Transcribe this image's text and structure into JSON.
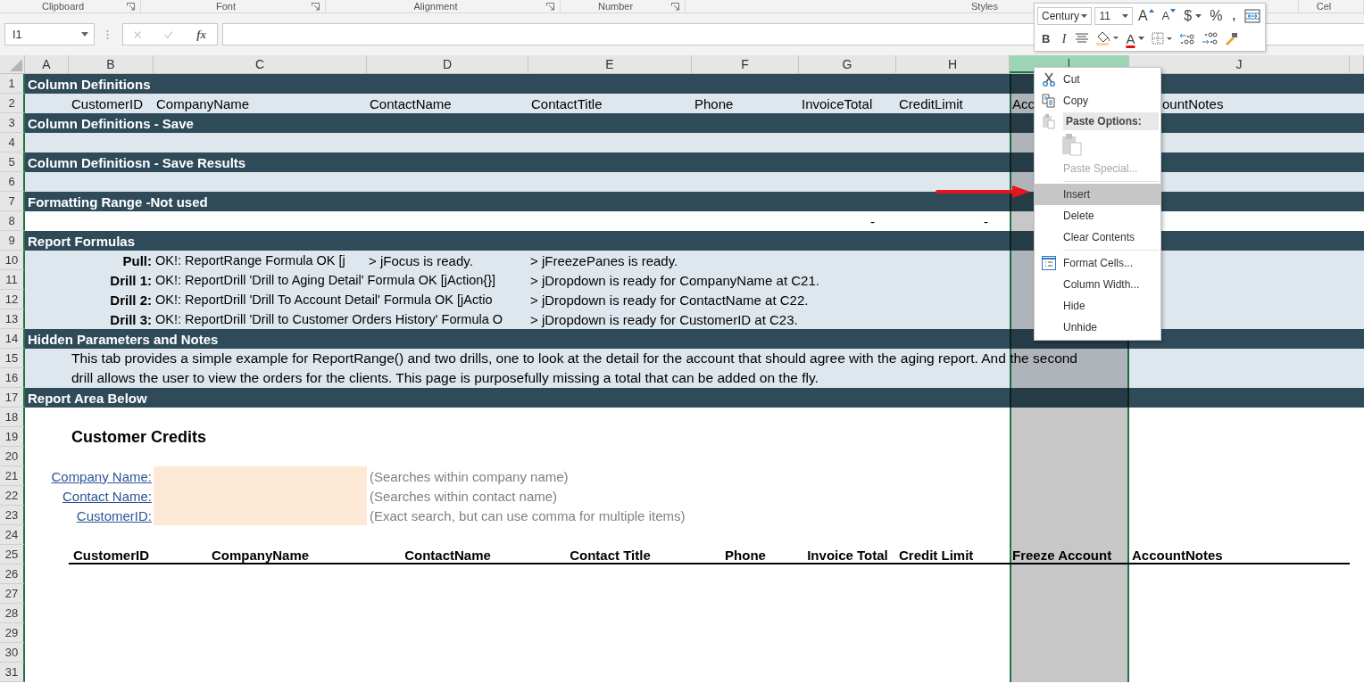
{
  "ribbon_groups": [
    {
      "label": "Clipboard",
      "launcher": true
    },
    {
      "label": "Font",
      "launcher": true
    },
    {
      "label": "Alignment",
      "launcher": true
    },
    {
      "label": "Number",
      "launcher": true
    },
    {
      "label": "Styles",
      "launcher": false
    },
    {
      "label": "Cel",
      "launcher": false
    }
  ],
  "formula_bar": {
    "name_box": "I1",
    "function_label": "fx"
  },
  "columns": [
    {
      "label": "A",
      "selected": false
    },
    {
      "label": "B",
      "selected": false
    },
    {
      "label": "C",
      "selected": false
    },
    {
      "label": "D",
      "selected": false
    },
    {
      "label": "E",
      "selected": false
    },
    {
      "label": "F",
      "selected": false
    },
    {
      "label": "G",
      "selected": false
    },
    {
      "label": "H",
      "selected": false
    },
    {
      "label": "I",
      "selected": true
    },
    {
      "label": "J",
      "selected": false
    }
  ],
  "rows": [
    {
      "n": "1",
      "kind": "section",
      "text": "Column Definitions"
    },
    {
      "n": "2",
      "kind": "fields",
      "cells": [
        "CustomerID",
        "CompanyName",
        "ContactName",
        "ContactTitle",
        "Phone",
        "InvoiceTotal",
        "CreditLimit",
        "Acc",
        "ountNotes"
      ]
    },
    {
      "n": "3",
      "kind": "section",
      "text": "Column Definitions - Save"
    },
    {
      "n": "4",
      "kind": "band"
    },
    {
      "n": "5",
      "kind": "section",
      "text": "Column Definitiosn - Save Results"
    },
    {
      "n": "6",
      "kind": "band"
    },
    {
      "n": "7",
      "kind": "section",
      "text": "Formatting Range -Not used"
    },
    {
      "n": "8",
      "kind": "dashes",
      "values": [
        "-",
        "-"
      ]
    },
    {
      "n": "9",
      "kind": "section",
      "text": "Report Formulas"
    },
    {
      "n": "10",
      "kind": "formula",
      "label": "Pull:",
      "status": "OK!: ReportRange Formula OK [j",
      "column_d": "> jFocus is ready.",
      "column_e": "> jFreezePanes is ready."
    },
    {
      "n": "11",
      "kind": "formula",
      "label": "Drill 1:",
      "status": "OK!: ReportDrill 'Drill to Aging Detail' Formula OK [jAction{}]",
      "column_e": "> jDropdown is ready for CompanyName at C21."
    },
    {
      "n": "12",
      "kind": "formula",
      "label": "Drill 2:",
      "status": "OK!: ReportDrill 'Drill To Account Detail' Formula OK [jActio",
      "column_e": "> jDropdown is ready for ContactName at C22."
    },
    {
      "n": "13",
      "kind": "formula",
      "label": "Drill 3:",
      "status": "OK!: ReportDrill 'Drill to Customer Orders History' Formula O",
      "column_e": "> jDropdown is ready for CustomerID at C23."
    },
    {
      "n": "14",
      "kind": "section",
      "text": "Hidden Parameters and Notes"
    },
    {
      "n": "15",
      "kind": "note",
      "text": "This tab provides a simple example for ReportRange() and two drills, one to look at the detail for the account that should agree with the aging report. And the second"
    },
    {
      "n": "16",
      "kind": "note",
      "text": "drill allows the user to view the orders for the clients.   This page is purposefully missing a total that can be added on the fly."
    },
    {
      "n": "17",
      "kind": "section",
      "text": "Report Area Below"
    },
    {
      "n": "18",
      "kind": "blank"
    },
    {
      "n": "19",
      "kind": "title",
      "text": "Customer Credits"
    },
    {
      "n": "20",
      "kind": "blank"
    },
    {
      "n": "21",
      "kind": "filter",
      "label": "Company Name:",
      "hint": "(Searches within company name)"
    },
    {
      "n": "22",
      "kind": "filter",
      "label": "Contact Name:",
      "hint": "(Searches within contact name)"
    },
    {
      "n": "23",
      "kind": "filter",
      "label": "CustomerID:",
      "hint": "(Exact search, but can use comma for multiple items)"
    },
    {
      "n": "24",
      "kind": "blank"
    },
    {
      "n": "25",
      "kind": "table_header",
      "cells": [
        "CustomerID",
        "CompanyName",
        "ContactName",
        "Contact Title",
        "Phone",
        "Invoice Total",
        "Credit Limit",
        "Freeze Account",
        "AccountNotes"
      ]
    },
    {
      "n": "26",
      "kind": "blank"
    },
    {
      "n": "27",
      "kind": "blank"
    },
    {
      "n": "28",
      "kind": "blank"
    },
    {
      "n": "29",
      "kind": "blank"
    },
    {
      "n": "30",
      "kind": "blank"
    },
    {
      "n": "31",
      "kind": "blank"
    }
  ],
  "mini_toolbar": {
    "font": "Century",
    "size": "11",
    "row1": [
      {
        "kind": "grow",
        "label": "A"
      },
      {
        "kind": "shrink",
        "label": "A"
      },
      {
        "kind": "currency",
        "label": "$"
      },
      {
        "kind": "percent",
        "label": "%"
      },
      {
        "kind": "comma",
        "label": ","
      },
      {
        "kind": "wrap"
      }
    ],
    "row2": [
      {
        "kind": "bold",
        "label": "B"
      },
      {
        "kind": "italic",
        "label": "I"
      },
      {
        "kind": "align"
      },
      {
        "kind": "fill"
      },
      {
        "kind": "fontcolor",
        "label": "A"
      },
      {
        "kind": "borders"
      },
      {
        "kind": "incdec"
      },
      {
        "kind": "decdec"
      },
      {
        "kind": "painter"
      }
    ]
  },
  "context_menu": {
    "items": [
      {
        "kind": "command",
        "label": "Cut",
        "selected": false,
        "disabled": false
      },
      {
        "kind": "command",
        "label": "Copy",
        "selected": false,
        "disabled": false
      },
      {
        "kind": "header",
        "label": "Paste Options:"
      },
      {
        "kind": "gallery",
        "disabled": true
      },
      {
        "kind": "command",
        "label": "Paste Special...",
        "selected": false,
        "disabled": true
      },
      {
        "kind": "separator"
      },
      {
        "kind": "command",
        "label": "Insert",
        "selected": true,
        "disabled": false
      },
      {
        "kind": "command",
        "label": "Delete",
        "selected": false,
        "disabled": false
      },
      {
        "kind": "command",
        "label": "Clear Contents",
        "selected": false,
        "disabled": false
      },
      {
        "kind": "separator"
      },
      {
        "kind": "command",
        "label": "Format Cells...",
        "selected": false,
        "disabled": false
      },
      {
        "kind": "command",
        "label": "Column Width...",
        "selected": false,
        "disabled": false
      },
      {
        "kind": "command",
        "label": "Hide",
        "selected": false,
        "disabled": false
      },
      {
        "kind": "command",
        "label": "Unhide",
        "selected": false,
        "disabled": false
      }
    ]
  }
}
